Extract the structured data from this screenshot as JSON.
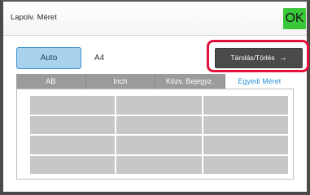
{
  "header": {
    "title": "Lapolv. Méret",
    "ok_label": "OK"
  },
  "controls": {
    "auto_label": "Auto",
    "selected_size": "A4",
    "store_delete_label": "Tárolás/Törlés",
    "store_delete_arrow": "→"
  },
  "tabs": [
    {
      "label": "AB",
      "active": false
    },
    {
      "label": "Inch",
      "active": false
    },
    {
      "label": "Közv. Bejegyz.",
      "active": false
    },
    {
      "label": "Egyedi Méret",
      "active": true
    }
  ],
  "custom_size_slots": [
    "",
    "",
    "",
    "",
    "",
    "",
    "",
    "",
    "",
    "",
    "",
    ""
  ],
  "colors": {
    "ok_button": "#39c83a",
    "auto_button": "#a9d2ee",
    "highlight_border": "#e3123c",
    "active_tab_text": "#2f95d4",
    "inactive_tab": "#9b9b9b"
  }
}
